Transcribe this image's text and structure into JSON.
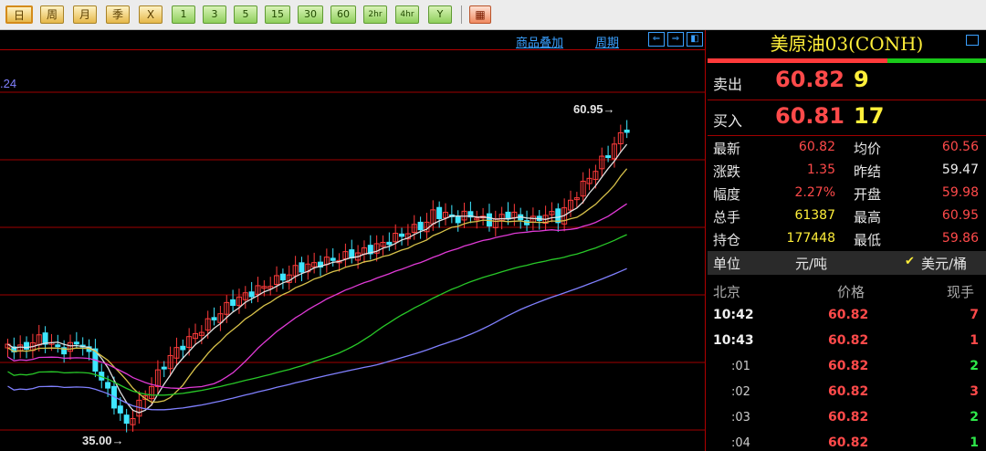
{
  "toolbar": {
    "buttons": [
      "日",
      "周",
      "月",
      "季",
      "X",
      "1",
      "3",
      "5",
      "15",
      "30",
      "60",
      "2hr",
      "4hr",
      "Y",
      "▦"
    ]
  },
  "chart": {
    "overlay_label": "商品叠加",
    "period_label": "周期",
    "axis_partial_label": ".24",
    "high_label": "60.95",
    "low_label": "35.00"
  },
  "quote": {
    "title": "美原油03(CONH)",
    "sell_label": "卖出",
    "sell_price": "60.82",
    "sell_volume": "9",
    "buy_label": "买入",
    "buy_price": "60.81",
    "buy_volume": "17",
    "stats_left": [
      {
        "label": "最新",
        "value": "60.82",
        "color": "red"
      },
      {
        "label": "涨跌",
        "value": "1.35",
        "color": "red"
      },
      {
        "label": "幅度",
        "value": "2.27%",
        "color": "red"
      },
      {
        "label": "总手",
        "value": "61387",
        "color": "yellow"
      },
      {
        "label": "持仓",
        "value": "177448",
        "color": "yellow"
      }
    ],
    "stats_right": [
      {
        "label": "均价",
        "value": "60.56",
        "color": "red"
      },
      {
        "label": "昨结",
        "value": "59.47",
        "color": "white"
      },
      {
        "label": "开盘",
        "value": "59.98",
        "color": "red"
      },
      {
        "label": "最高",
        "value": "60.95",
        "color": "red"
      },
      {
        "label": "最低",
        "value": "59.86",
        "color": "red"
      }
    ],
    "unit_label": "单位",
    "unit_cny": "元/吨",
    "unit_usd": "美元/桶",
    "unit_check": "✔",
    "ticks_header": {
      "time": "北京",
      "price": "价格",
      "volume": "现手"
    },
    "ticks": [
      {
        "time": "10:42",
        "price": "60.82",
        "volume": "7",
        "dir": "red",
        "sub": false
      },
      {
        "time": "10:43",
        "price": "60.82",
        "volume": "1",
        "dir": "red",
        "sub": false
      },
      {
        "time": ":01",
        "price": "60.82",
        "volume": "2",
        "dir": "green",
        "sub": true
      },
      {
        "time": ":02",
        "price": "60.82",
        "volume": "3",
        "dir": "red",
        "sub": true
      },
      {
        "time": ":03",
        "price": "60.82",
        "volume": "2",
        "dir": "green",
        "sub": true
      },
      {
        "time": ":04",
        "price": "60.82",
        "volume": "1",
        "dir": "green",
        "sub": true
      }
    ]
  },
  "colors": {
    "up": "#ff3b3b",
    "down": "#3fe6ff",
    "ma5": "#e0e0e0",
    "ma10": "#d8c24a",
    "ma20": "#e03ad6",
    "ma40": "#28c828",
    "ma60": "#8080ff",
    "grid": "#a00000"
  }
}
